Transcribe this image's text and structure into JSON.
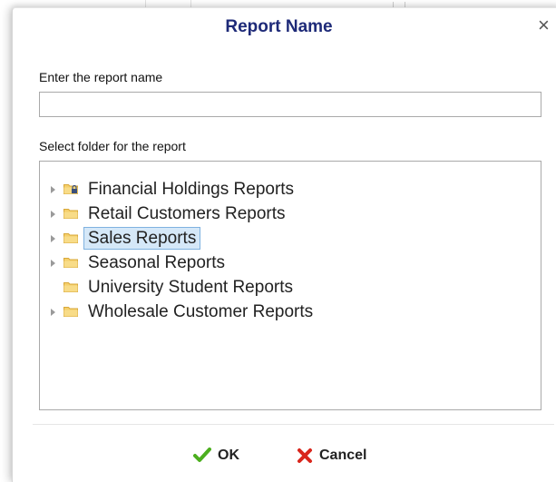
{
  "dialog": {
    "title": "Report Name",
    "close_glyph": "×",
    "name_label": "Enter the report name",
    "name_value": "",
    "name_placeholder": "",
    "folder_label": "Select folder for the report"
  },
  "folders": [
    {
      "label": "Financial Holdings Reports",
      "expandable": true,
      "locked": true,
      "selected": false
    },
    {
      "label": "Retail Customers Reports",
      "expandable": true,
      "locked": false,
      "selected": false
    },
    {
      "label": "Sales Reports",
      "expandable": true,
      "locked": false,
      "selected": true
    },
    {
      "label": "Seasonal Reports",
      "expandable": true,
      "locked": false,
      "selected": false
    },
    {
      "label": "University Student Reports",
      "expandable": false,
      "locked": false,
      "selected": false
    },
    {
      "label": "Wholesale Customer Reports",
      "expandable": true,
      "locked": false,
      "selected": false
    }
  ],
  "buttons": {
    "ok_label": "OK",
    "cancel_label": "Cancel"
  },
  "icons": {
    "ok": "checkmark-icon",
    "cancel": "x-icon",
    "folder": "folder-icon",
    "expand": "triangle-right-icon",
    "lock": "lock-icon"
  },
  "colors": {
    "title": "#1e2a78",
    "ok_check": "#4caf1f",
    "cancel_x": "#d9261c",
    "folder": "#f5cf6b",
    "selection_bg": "#d5e8f8",
    "selection_border": "#7fb2e0"
  }
}
